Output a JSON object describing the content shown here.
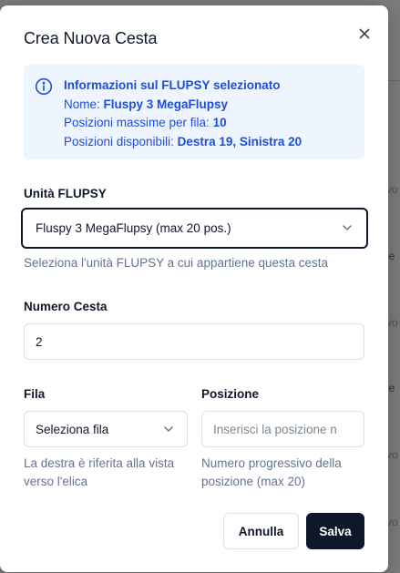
{
  "background": {
    "fragments": [
      "vo",
      "le",
      "vo",
      "le",
      "vo",
      "vo"
    ]
  },
  "dialog": {
    "title": "Crea Nuova Cesta",
    "close_icon": "close-icon",
    "info": {
      "icon": "info-icon",
      "heading": "Informazioni sul FLUPSY selezionato",
      "name_label": "Nome:",
      "name_value": "Fluspy 3 MegaFlupsy",
      "max_label": "Posizioni massime per fila:",
      "max_value": "10",
      "avail_label": "Posizioni disponibili:",
      "avail_value": "Destra 19, Sinistra 20"
    },
    "flupsy": {
      "label": "Unità FLUPSY",
      "selected": "Fluspy 3 MegaFlupsy (max 20 pos.)",
      "hint": "Seleziona l'unità FLUPSY a cui appartiene questa cesta"
    },
    "numero": {
      "label": "Numero Cesta",
      "value": "2"
    },
    "fila": {
      "label": "Fila",
      "selected": "Seleziona fila",
      "hint_line1": "La destra è riferita alla vista",
      "hint_line2": "verso l'elica"
    },
    "posizione": {
      "label": "Posizione",
      "placeholder": "Inserisci la posizione n",
      "hint_line1": "Numero progressivo della",
      "hint_line2": "posizione (max 20)"
    },
    "buttons": {
      "cancel": "Annulla",
      "save": "Salva"
    }
  },
  "colors": {
    "accent": "#1d4ed8",
    "info_bg": "#eef5fe",
    "primary_button": "#0f172a",
    "muted_text": "#64748b"
  }
}
